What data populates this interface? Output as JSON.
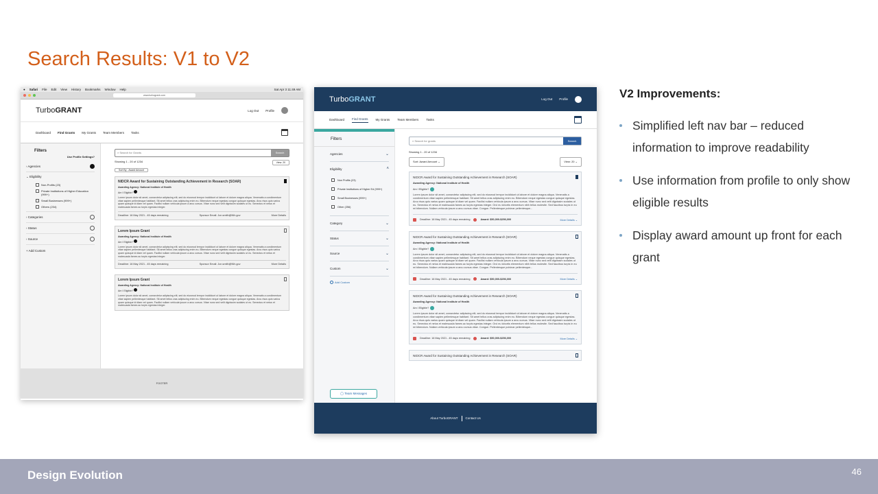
{
  "slide": {
    "title": "Search Results: V1 to V2",
    "footer_label": "Design Evolution",
    "page_number": "46"
  },
  "improvements": {
    "heading": "V2 Improvements:",
    "items": [
      "Simplified left nav bar – reduced information to improve readability",
      "Use information from profile to only show eligible results",
      "Display award amount up front for each grant"
    ]
  },
  "v1": {
    "mac_menu": [
      "Safari",
      "File",
      "Edit",
      "View",
      "History",
      "Bookmarks",
      "Window",
      "Help"
    ],
    "mac_status": "Sat Apr 3 11:49 AM",
    "url": "www.turbogrant.com",
    "logo_a": "Turbo",
    "logo_b": "GRANT",
    "logout": "Log Out",
    "profile": "Profile",
    "nav": [
      "Dashboard",
      "Find Grants",
      "My Grants",
      "Team Members",
      "Tasks"
    ],
    "filters_title": "Filters",
    "use_profile": "Use Profile Settings?",
    "filter_rows": [
      "Agencies",
      "Eligibility"
    ],
    "eligibility_opts": [
      "Non-Profits (23)",
      "Private Institutions of Higher Education (999+)",
      "Small Businesses (999+)",
      "Others (234)"
    ],
    "filter_rows_b": [
      "Categories",
      "Status",
      "Source"
    ],
    "add_custom": "Add Custom",
    "search_placeholder": "Search for Grants",
    "search_btn": "Search",
    "showing": "Showing 1 - 20 of 1234",
    "view": "View: 20",
    "sort": "Sort By - Award Amount",
    "cards": [
      {
        "title": "NIDCR Award for Sustaining Outstanding Achievement in Research (SOAR)",
        "agency": "Awarding Agency: National Institute of Health",
        "elig": "Am I Eligible?",
        "deadline": "Deadline: 16 May 2021 - 45 days remaining",
        "sponsor": "Sponsor Email: Jon.smith@NIh.gov",
        "more": "More Details"
      },
      {
        "title": "Lorem Ipsum Grant",
        "agency": "Awarding Agency: National Institute of Health",
        "elig": "Am I Eligible?",
        "deadline": "Deadline: 16 May 2021 - 45 days remaining",
        "sponsor": "Sponsor Email: Jon.smith@NIh.gov",
        "more": "More Details"
      },
      {
        "title": "Lorem Ipsum Grant",
        "agency": "Awarding Agency: National Institute of Health",
        "elig": "Am I Eligible?",
        "deadline": "",
        "sponsor": "",
        "more": ""
      }
    ],
    "lorem": "Lorem ipsum dolor sit amet, consectetur adipiscing elit, sed do eiusmod tempor incididunt ut labore et dolore magna aliqua. Venenatis a condimentum vitae sapien pellentesque habitant. Sit amet tellus cras adipiscing enim eu. Bibendum neque egestas congue quisque egestas. Arcu risus quis varius quam quisque id diam vel quam. Facilisi nullam vehicula ipsum a arcu cursus. Vitae nunc sed velit dignissim sodales ut eu. Senectus et netus et malesuada fames ac turpis egestas integer.",
    "footer": "FOOTER"
  },
  "v2": {
    "logo_a": "Turbo",
    "logo_b": "GRANT",
    "logout": "Log Out",
    "profile": "Profile",
    "nav": [
      "Dashboard",
      "Find Grants",
      "My Grants",
      "Team Members",
      "Tasks"
    ],
    "filters_title": "Filters",
    "filter_rows": [
      "Agencies",
      "Eligibility"
    ],
    "eligibility_opts": [
      "Non Profits (23)",
      "Private Institutions of Higher Ed (999+)",
      "Small Businesses (999+)",
      "Other (256)"
    ],
    "filter_rows_b": [
      "Category",
      "Status",
      "Source",
      "Custom"
    ],
    "add_custom": "Add Custom",
    "team_messages": "Team Messages",
    "search_placeholder": "Search for grants",
    "search_btn": "Search",
    "showing": "Showing 1 - 20 of 1234",
    "sort": "Sort: Award Amount",
    "view": "View: 20",
    "cards": [
      {
        "title": "NIDCR Award for Sustaining Outstanding Achievement in Research (SOAR)",
        "agency": "Awarding Agency: National Institute of Health",
        "elig": "Am I Eligible?",
        "deadline": "Deadline: 16 May 2021 - 45 days remaining",
        "award": "Award: $50,000-$256,000",
        "more": "More Details"
      },
      {
        "title": "NIDCR Award for Sustaining Outstanding Achievement in Research (SOAR)",
        "agency": "Awarding Agency: National Institute of Health",
        "elig": "Am I Eligible?",
        "deadline": "Deadline: 16 May 2021 - 45 days remaining",
        "award": "Award: $50,000-$256,000",
        "more": "More Details"
      },
      {
        "title": "NIDCR Award for Sustaining Outstanding Achievement in Research (SOAR)",
        "agency": "Awarding Agency: National Institute of Health",
        "elig": "Am I Eligible?",
        "deadline": "Deadline: 16 May 2021 - 45 days remaining",
        "award": "Award: $50,000-$256,000",
        "more": "More Details"
      },
      {
        "title": "NIDCR Award for Sustaining Outstanding Achievement in Research (SOAR)",
        "agency": "",
        "elig": "",
        "deadline": "",
        "award": "",
        "more": ""
      }
    ],
    "lorem": "Lorem ipsum dolor sit amet, consectetur adipiscing elit, sed do eiusmod tempor incididunt ut labore et dolore magna aliqua. Venenatis a condimentum vitae sapien pellentesque habitant. Sit amet tellus cras adipiscing enim eu. Bibendum neque egestas congue quisque egestas. Arcu risus quis varius quam quisque id diam vel quam. Facilisi nullam vehicula ipsum a arcu cursus. Vitae nunc sed velit dignissim sodales ut eu. Senectus et netus et malesuada fames ac turpis egestas integer. Orci eu lobortis elementum nibh tellus molestie. Sed faucibus turpis in eu mi bibendum. Nullam vehicula ipsum a arcu cursus vitae. Congue. Pellentesque pulvinar pellentesque...",
    "footer_links": [
      "About TurboGRANT",
      "Contact Us"
    ]
  },
  "colors": {
    "title": "#d35f1a",
    "navy": "#1d3c5e",
    "teal": "#3aa7a0",
    "band": "#a3a6b9"
  }
}
